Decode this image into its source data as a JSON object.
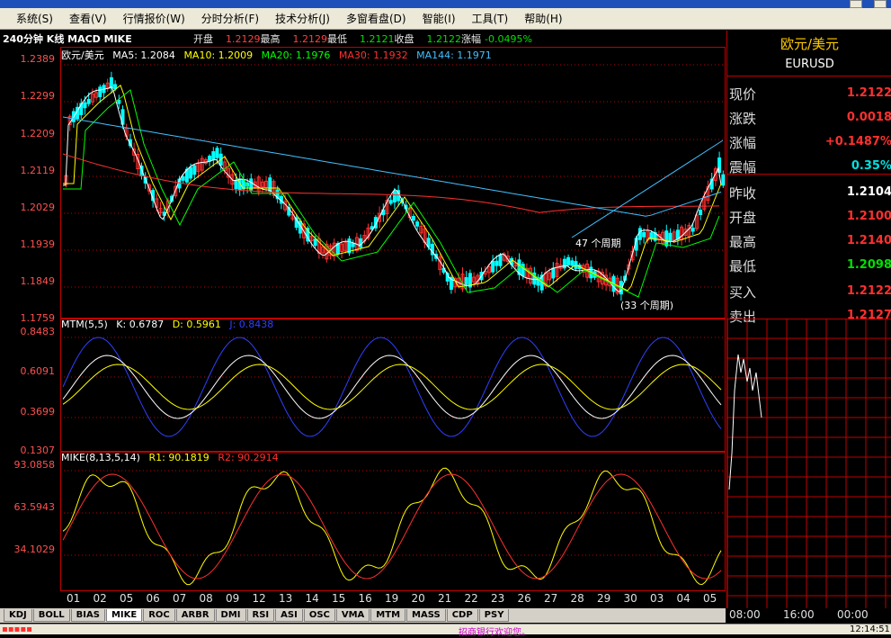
{
  "menu": [
    "系统(S)",
    "查看(V)",
    "行情报价(W)",
    "分时分析(F)",
    "技术分析(J)",
    "多窗看盘(D)",
    "智能(I)",
    "工具(T)",
    "帮助(H)"
  ],
  "infobar": {
    "title": "240分钟 K线 MACD MIKE",
    "open_label": "开盘",
    "open": "1.2129",
    "high_label": "最高",
    "high": "1.2129",
    "low_label": "最低",
    "low": "1.2121",
    "close_label": "收盘",
    "close": "1.2122",
    "change_label": "涨幅",
    "change": "-0.0495%"
  },
  "main_chart": {
    "name": "欧元/美元",
    "ma5": "MA5: 1.2084",
    "ma10": "MA10: 1.2009",
    "ma20": "MA20: 1.1976",
    "ma30": "MA30: 1.1932",
    "ma144": "MA144: 1.1971",
    "y_ticks": [
      "1.2389",
      "1.2299",
      "1.2209",
      "1.2119",
      "1.2029",
      "1.1939",
      "1.1849",
      "1.1759"
    ],
    "annotation1": "47 个周期",
    "annotation2": "(33 个周期)"
  },
  "mtm_chart": {
    "title": "MTM(5,5)",
    "k": "K: 0.6787",
    "d": "D: 0.5961",
    "j": "J: 0.8438",
    "y_ticks": [
      "0.8483",
      "0.6091",
      "0.3699",
      "0.1307"
    ]
  },
  "mike_chart": {
    "title": "MIKE(8,13,5,14)",
    "r1": "R1: 90.1819",
    "r2": "R2: 90.2914",
    "y_ticks": [
      "93.0858",
      "63.5943",
      "34.1029"
    ]
  },
  "x_labels": [
    "01",
    "02",
    "05",
    "06",
    "07",
    "08",
    "09",
    "12",
    "13",
    "14",
    "15",
    "16",
    "19",
    "20",
    "21",
    "22",
    "23",
    "26",
    "27",
    "28",
    "29",
    "30",
    "03",
    "04",
    "05"
  ],
  "tabs": [
    "KDJ",
    "BOLL",
    "BIAS",
    "MIKE",
    "ROC",
    "ARBR",
    "DMI",
    "RSI",
    "ASI",
    "OSC",
    "VMA",
    "MTM",
    "MASS",
    "CDP",
    "PSY"
  ],
  "active_tab": "MIKE",
  "right_panel": {
    "name": "欧元/美元",
    "code": "EURUSD",
    "rows": [
      {
        "k": "现价",
        "v": "1.2122",
        "c": "#ff3030"
      },
      {
        "k": "涨跌",
        "v": "0.0018",
        "c": "#ff3030"
      },
      {
        "k": "涨幅",
        "v": "+0.1487%",
        "c": "#ff3030"
      },
      {
        "k": "震幅",
        "v": "0.35%",
        "c": "#00e0e0"
      },
      {
        "k": "昨收",
        "v": "1.2104",
        "c": "#ffffff"
      },
      {
        "k": "开盘",
        "v": "1.2100",
        "c": "#ff3030"
      },
      {
        "k": "最高",
        "v": "1.2140",
        "c": "#ff3030"
      },
      {
        "k": "最低",
        "v": "1.2098",
        "c": "#00e000"
      },
      {
        "k": "买入",
        "v": "1.2122",
        "c": "#ff3030"
      },
      {
        "k": "卖出",
        "v": "1.2127",
        "c": "#ff3030"
      }
    ],
    "time_labels": [
      "08:00",
      "16:00",
      "00:00"
    ]
  },
  "status": {
    "ticker": "招商银行欢迎您。",
    "clock": "12:14:51"
  },
  "colors": {
    "grid": "#c00000",
    "up": "#ff3030",
    "down": "#00ffff",
    "ma5": "#ffffff",
    "ma10": "#ffff00",
    "ma20": "#00ff00",
    "ma30": "#ff3030",
    "ma144": "#40c0ff"
  }
}
